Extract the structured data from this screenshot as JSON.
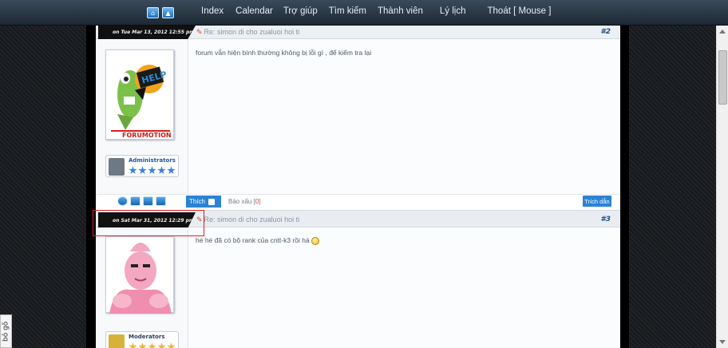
{
  "nav": {
    "links": [
      "Index",
      "Calendar",
      "Trợ giúp",
      "Tìm kiếm",
      "Thành viên",
      "Lý lịch",
      "Thoát [ Mouse ]"
    ]
  },
  "side_button": "bỏ gõ",
  "posts": [
    {
      "date": "on Tue Mar 13, 2012 12:55 pm",
      "title": "Re: simon di cho zualuoi hoi ti",
      "number": "#2",
      "message": "forum vẫn hiện bình thường không bị lỗi gì , để kiểm tra lại",
      "avatar_caption": "FORUMOTION",
      "avatar_badge": "HELP",
      "rank": "Administrators",
      "like": "Thích",
      "report": "Báo xấu",
      "report_count": "0",
      "quote": "Trích dẫn"
    },
    {
      "date": "on Sat Mar 31, 2012 12:29 pm",
      "title": "Re: simon di cho zualuoi hoi ti",
      "number": "#3",
      "message": "hé hé đã có bộ rank của cntt-k3 rồi hà",
      "rank": "Moderators"
    }
  ],
  "colors": {
    "nav_bg": "#1d2834",
    "accent": "#2a83d4",
    "highlight": "#e02020"
  }
}
